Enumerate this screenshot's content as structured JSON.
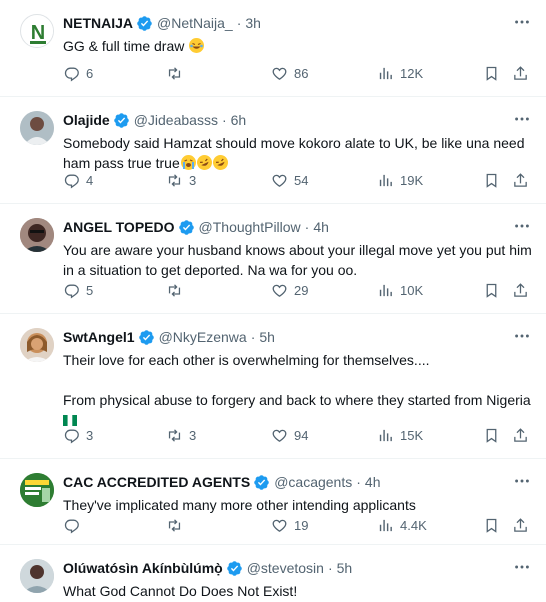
{
  "tweets": [
    {
      "name": "NETNAIJA",
      "handle": "@NetNaija_",
      "time": "3h",
      "lines": [
        "GG & full time draw"
      ],
      "emoji": "laugh",
      "replies": "6",
      "retweets": "",
      "likes": "86",
      "views": "12K",
      "avatar_color": "#2e7d32"
    },
    {
      "name": "Olajide",
      "handle": "@Jideabasss",
      "time": "6h",
      "lines": [
        "Somebody said Hamzat should move kokoro alate to UK, be like una need",
        "ham pass true true"
      ],
      "emoji": "cry-rofl",
      "replies": "4",
      "retweets": "3",
      "likes": "54",
      "views": "19K",
      "avatar_color": "#6d4c41"
    },
    {
      "name": "ANGEL TOPEDO",
      "handle": "@ThoughtPillow",
      "time": "4h",
      "lines": [
        "You are aware your husband knows about your illegal move yet you put him",
        "in a situation to get deported. Na wa for you oo."
      ],
      "emoji": "",
      "replies": "5",
      "retweets": "",
      "likes": "29",
      "views": "10K",
      "avatar_color": "#3e2723"
    },
    {
      "name": "SwtAngel1",
      "handle": "@NkyEzenwa",
      "time": "5h",
      "lines": [
        "Their love for each other is overwhelming  for themselves....",
        "",
        "From physical abuse to forgery and back to where they started from Nigeria"
      ],
      "emoji": "flag-ng",
      "replies": "3",
      "retweets": "3",
      "likes": "94",
      "views": "15K",
      "avatar_color": "#c98f5b"
    },
    {
      "name": "CAC ACCREDITED AGENTS",
      "handle": "@cacagents",
      "time": "4h",
      "lines": [
        "They've implicated many more other intending applicants"
      ],
      "emoji": "",
      "replies": "",
      "retweets": "",
      "likes": "19",
      "views": "4.4K",
      "avatar_color": "#2e7d32"
    },
    {
      "name": "Olúwatósìn Akínbùlúmọ̀",
      "handle": "@stevetosin",
      "time": "5h",
      "lines": [
        "What God Cannot Do Does Not Exist!"
      ],
      "emoji": "",
      "replies": "",
      "retweets": "",
      "likes": "",
      "views": "",
      "avatar_color": "#78909c"
    }
  ],
  "colors": {
    "verified": "#1d9bf0",
    "muted": "#536471",
    "text": "#0f1419",
    "divider": "#eff3f4"
  }
}
